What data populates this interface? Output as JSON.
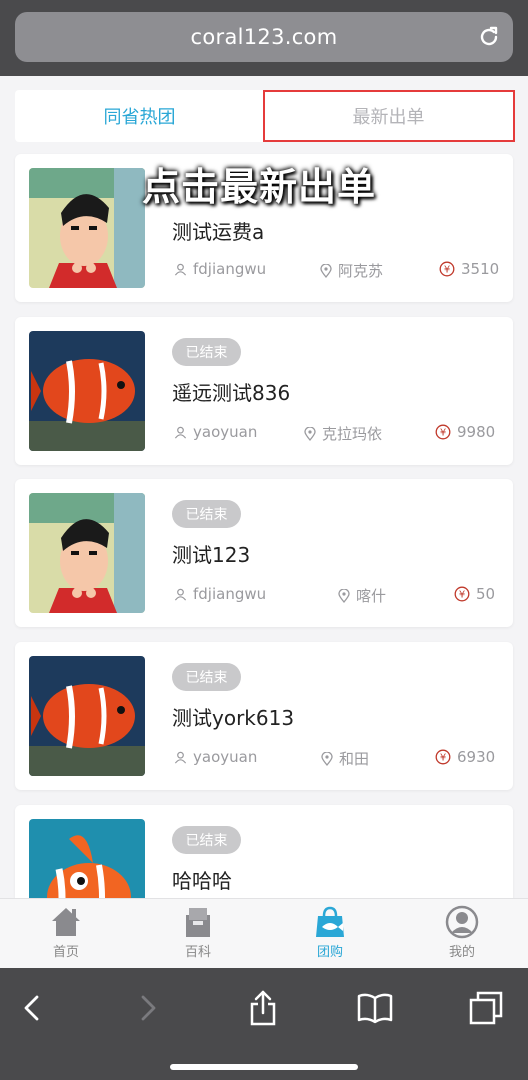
{
  "browser": {
    "url": "coral123.com"
  },
  "tabs": {
    "left_label": "同省热团",
    "right_label": "最新出单"
  },
  "overlay": {
    "caption": "点击最新出单"
  },
  "cards": [
    {
      "status": "",
      "title": "测试运费a",
      "user": "fdjiangwu",
      "location": "阿克苏",
      "price": "3510",
      "thumb": "cartoon"
    },
    {
      "status": "已结束",
      "title": "遥远测试836",
      "user": "yaoyuan",
      "location": "克拉玛依",
      "price": "9980",
      "thumb": "fish"
    },
    {
      "status": "已结束",
      "title": "测试123",
      "user": "fdjiangwu",
      "location": "喀什",
      "price": "50",
      "thumb": "cartoon"
    },
    {
      "status": "已结束",
      "title": "测试york613",
      "user": "yaoyuan",
      "location": "和田",
      "price": "6930",
      "thumb": "fish"
    },
    {
      "status": "已结束",
      "title": "哈哈哈",
      "user": "",
      "location": "",
      "price": "",
      "thumb": "clownfish"
    }
  ],
  "tabbar": [
    {
      "label": "首页",
      "icon": "home-icon"
    },
    {
      "label": "百科",
      "icon": "encyclopedia-icon"
    },
    {
      "label": "团购",
      "icon": "group-buy-icon"
    },
    {
      "label": "我的",
      "icon": "profile-icon"
    }
  ],
  "colors": {
    "accent": "#2aa7d6",
    "highlight": "#e53b3b",
    "price": "#c0392b"
  }
}
